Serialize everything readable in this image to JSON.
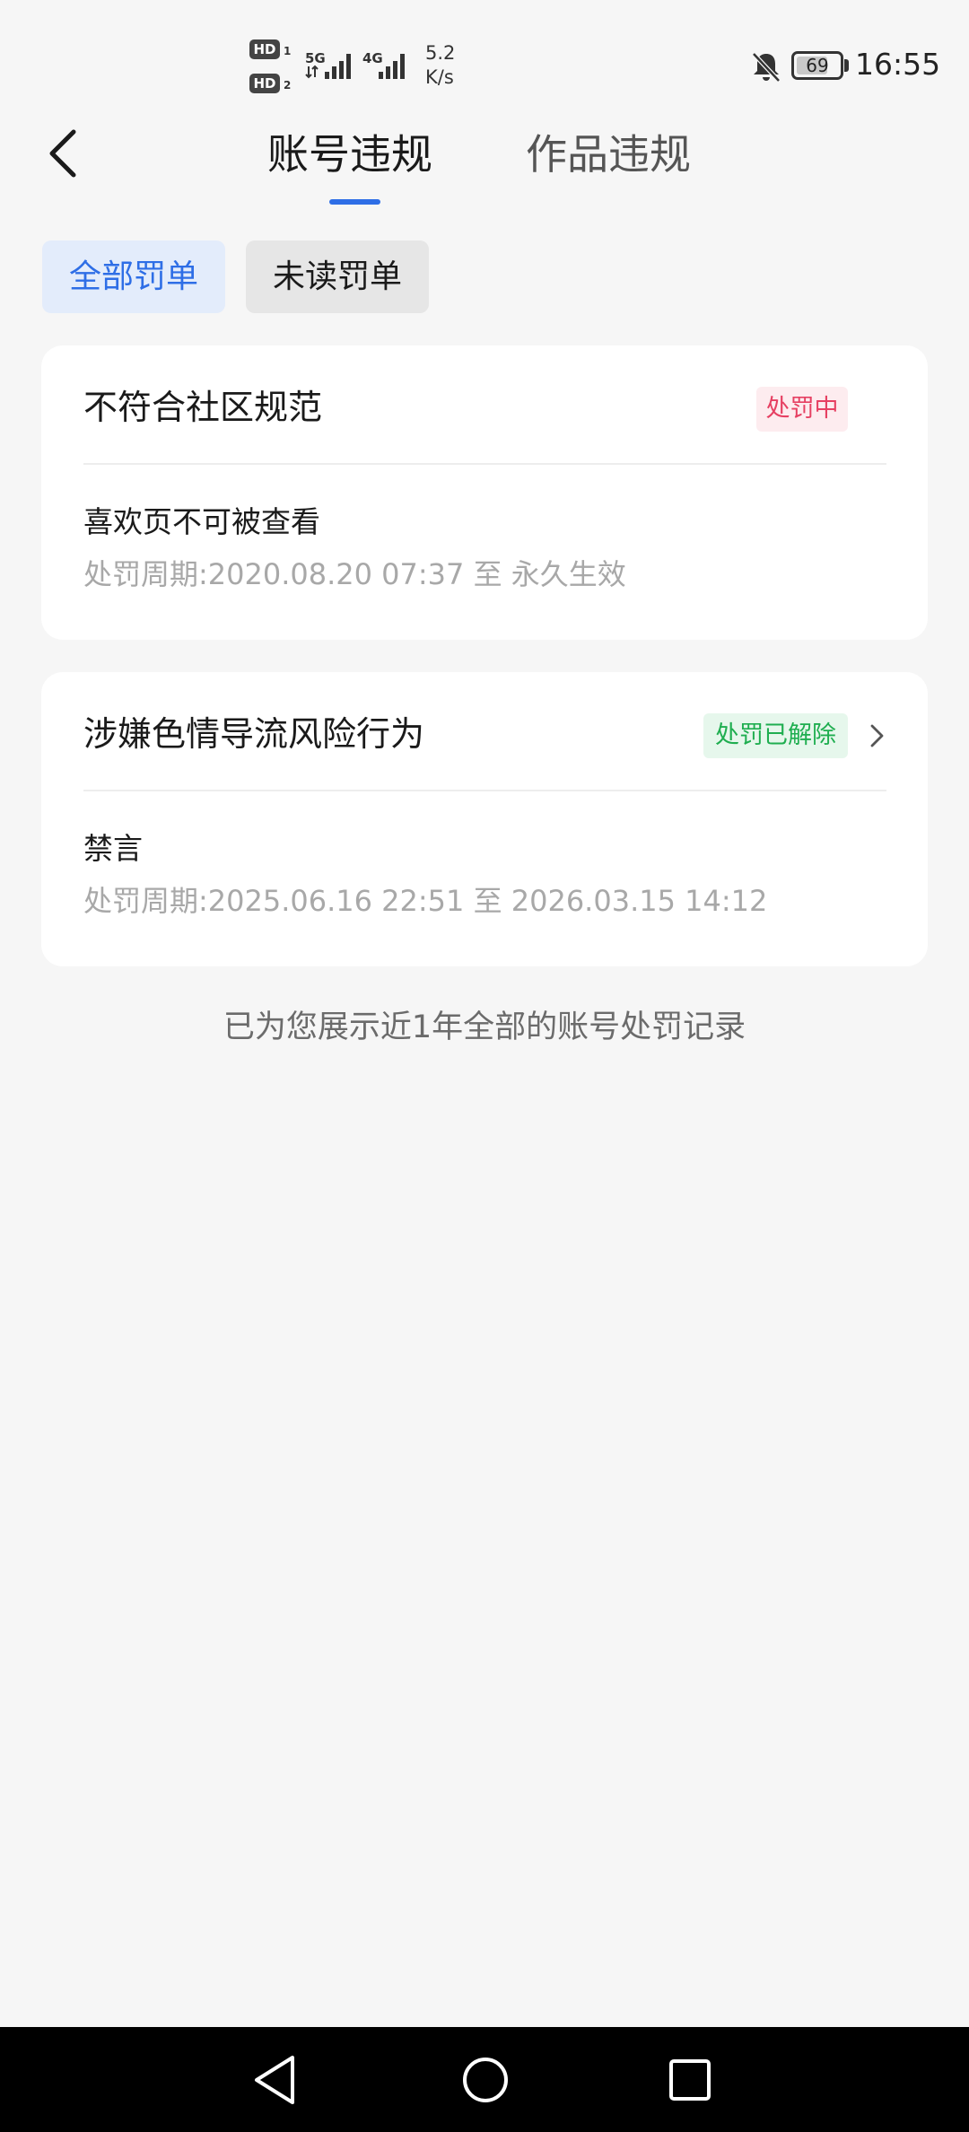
{
  "status_bar": {
    "hd1": "HD",
    "hd1_sub": "1",
    "hd2": "HD",
    "hd2_sub": "2",
    "net1": "5G",
    "net2": "4G",
    "speed_value": "5.2",
    "speed_unit": "K/s",
    "battery": "69",
    "time": "16:55",
    "icons": [
      "signal-icon",
      "bell-off-icon",
      "battery-icon"
    ]
  },
  "header": {
    "tabs": [
      {
        "label": "账号违规",
        "active": true
      },
      {
        "label": "作品违规",
        "active": false
      }
    ],
    "back_icon": "chevron-left-icon",
    "accent_color": "#2e6ee6"
  },
  "filters": [
    {
      "label": "全部罚单",
      "selected": true
    },
    {
      "label": "未读罚单",
      "selected": false
    }
  ],
  "penalties": [
    {
      "title": "不符合社区规范",
      "status": "处罚中",
      "status_color": "#e64062",
      "action": "喜欢页不可被查看",
      "period": "处罚周期:2020.08.20 07:37 至 永久生效",
      "has_detail": false
    },
    {
      "title": "涉嫌色情导流风险行为",
      "status": "处罚已解除",
      "status_color": "#1fae50",
      "action": "禁言",
      "period": "处罚周期:2025.06.16 22:51 至 2026.03.15 14:12",
      "has_detail": true
    }
  ],
  "footer_note": "已为您展示近1年全部的账号处罚记录",
  "nav_bar": {
    "icons": [
      "nav-back-icon",
      "nav-home-icon",
      "nav-recent-icon"
    ]
  }
}
